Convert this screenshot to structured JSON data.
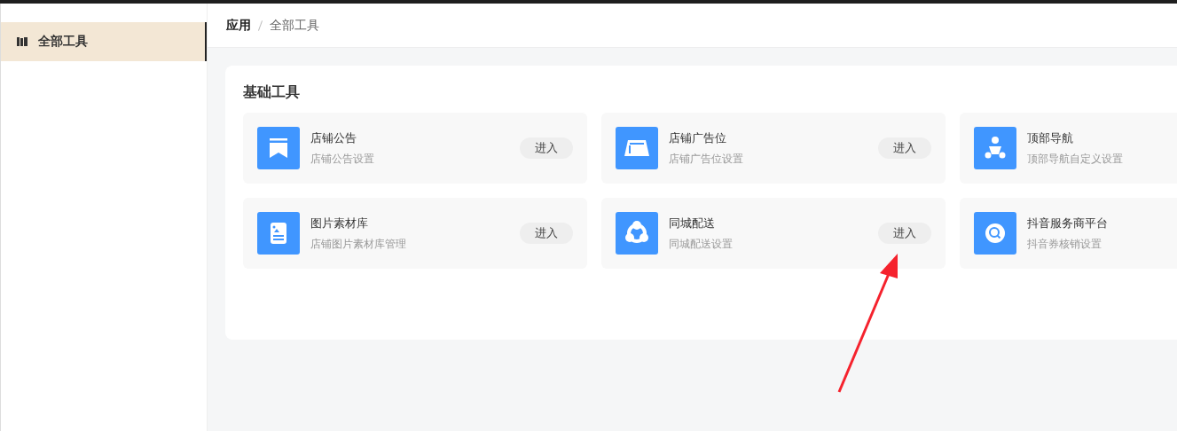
{
  "sidebar": {
    "items": [
      {
        "label": "全部工具",
        "selected": true
      }
    ]
  },
  "breadcrumb": [
    "应用",
    "全部工具"
  ],
  "section": {
    "title": "基础工具",
    "tools": [
      {
        "kind": "bookmark",
        "title": "店铺公告",
        "subtitle": "店铺公告设置",
        "button": "进入"
      },
      {
        "kind": "tray",
        "title": "店铺广告位",
        "subtitle": "店铺广告位设置",
        "button": "进入"
      },
      {
        "kind": "people",
        "title": "顶部导航",
        "subtitle": "顶部导航自定义设置"
      },
      {
        "kind": "image",
        "title": "图片素材库",
        "subtitle": "店铺图片素材库管理",
        "button": "进入"
      },
      {
        "kind": "share",
        "title": "同城配送",
        "subtitle": "同城配送设置",
        "button": "进入"
      },
      {
        "kind": "search",
        "title": "抖音服务商平台",
        "subtitle": "抖音券核销设置"
      }
    ]
  }
}
